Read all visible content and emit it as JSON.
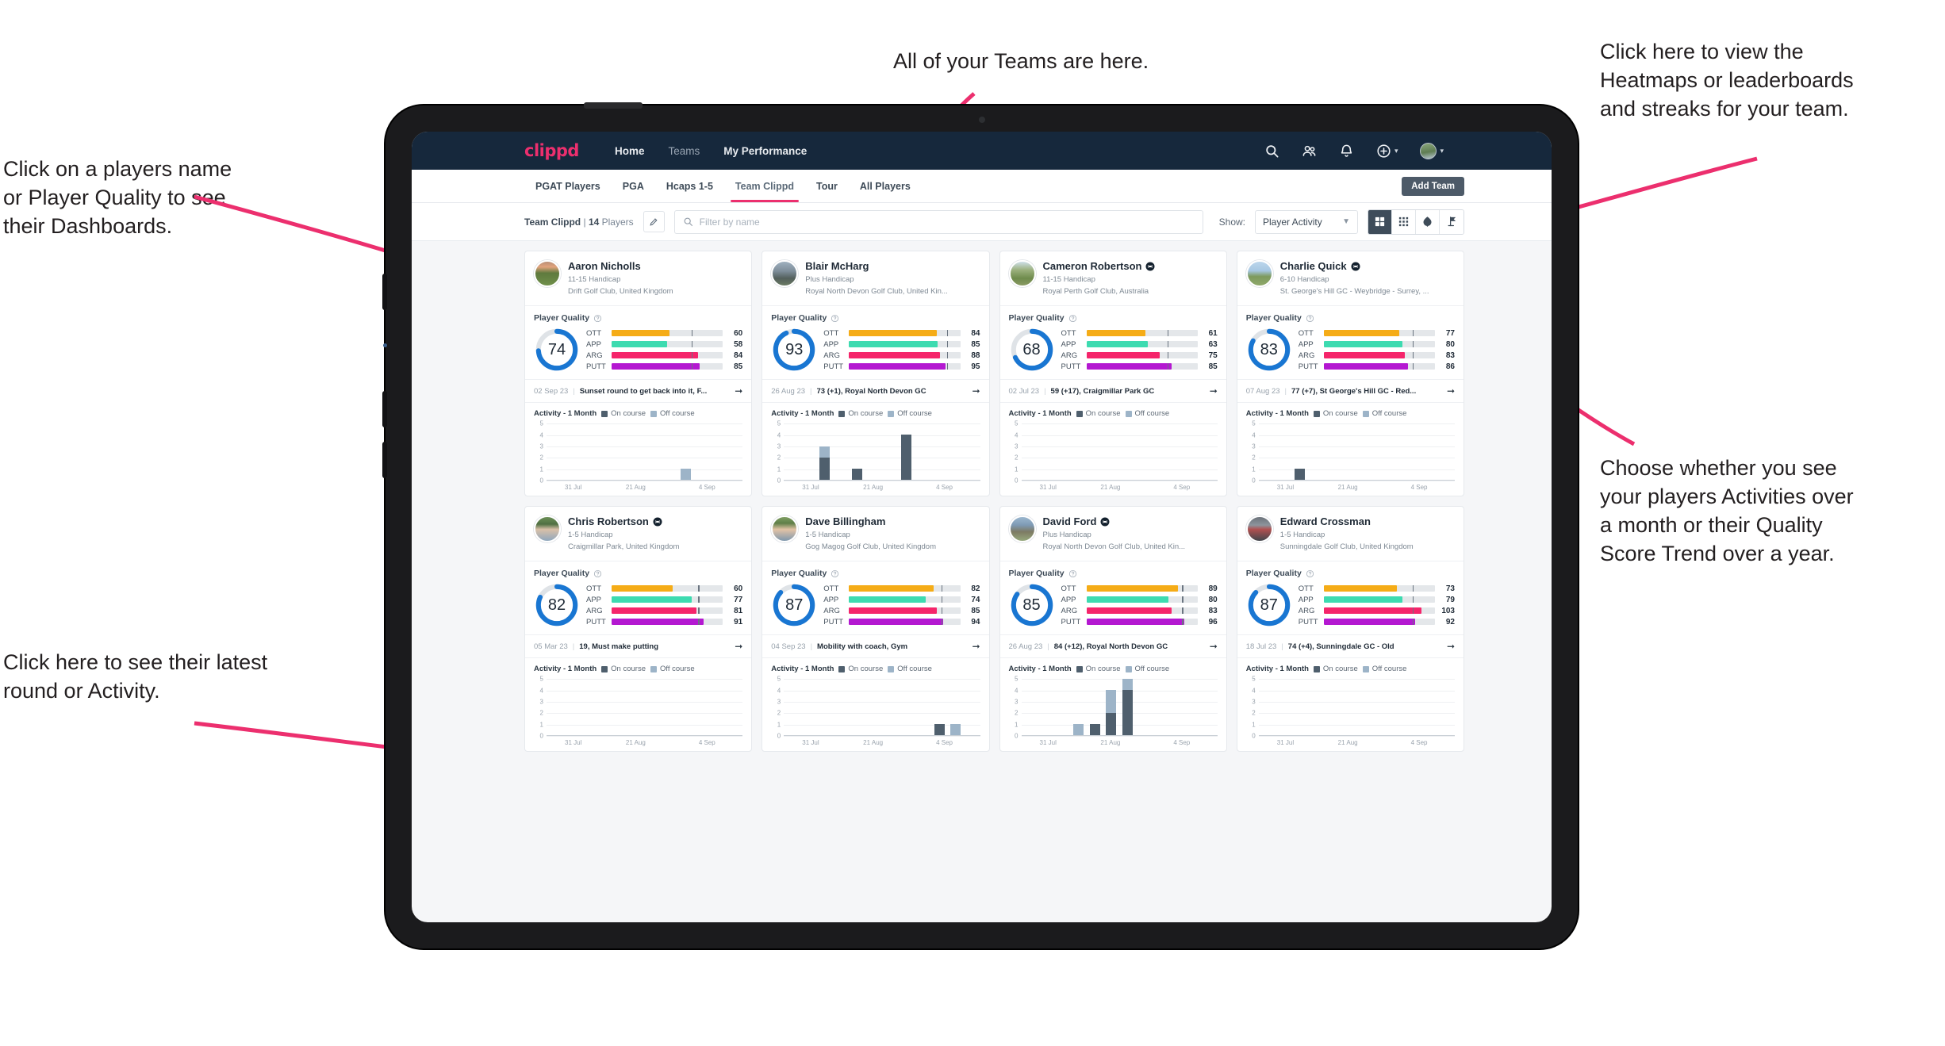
{
  "annotations": [
    {
      "id": "teams",
      "text": "All of your Teams are here."
    },
    {
      "id": "heatmaps",
      "text": "Click here to view the\nHeatmaps or leaderboards\nand streaks for your team."
    },
    {
      "id": "player-name",
      "text": "Click on a players name\nor Player Quality to see\ntheir Dashboards."
    },
    {
      "id": "activity-choice",
      "text": "Choose whether you see\nyour players Activities over\na month or their Quality\nScore Trend over a year."
    },
    {
      "id": "latest-round",
      "text": "Click here to see their latest\nround or Activity."
    }
  ],
  "navbar": {
    "brand": "clippd",
    "links": [
      {
        "label": "Home",
        "active": true
      },
      {
        "label": "Teams",
        "active": false
      },
      {
        "label": "My Performance",
        "active": true
      }
    ],
    "icons": [
      "search-icon",
      "people-icon",
      "bell-icon",
      "plus-circle-icon"
    ],
    "avatar": "user-avatar"
  },
  "tabs": [
    {
      "label": "PGAT Players",
      "active": false
    },
    {
      "label": "PGA",
      "active": false
    },
    {
      "label": "Hcaps 1-5",
      "active": false
    },
    {
      "label": "Team Clippd",
      "active": true
    },
    {
      "label": "Tour",
      "active": false
    },
    {
      "label": "All Players",
      "active": false
    }
  ],
  "add_team_label": "Add Team",
  "filterbar": {
    "team_name": "Team Clippd",
    "separator": "|",
    "player_count": "14",
    "players_word": "Players",
    "edit_icon": "pencil-icon",
    "search_placeholder": "Filter by name",
    "search_value": "",
    "show_label": "Show:",
    "show_value": "Player Activity",
    "show_options": [
      "Player Activity",
      "Quality Score Trend"
    ],
    "view_buttons": [
      {
        "icon": "grid-large-icon",
        "active": true
      },
      {
        "icon": "grid-small-icon",
        "active": false
      },
      {
        "icon": "heatmap-icon",
        "active": false
      },
      {
        "icon": "flag-icon",
        "active": false
      }
    ]
  },
  "card_labels": {
    "quality_title": "Player Quality",
    "activity_title": "Activity - 1 Month",
    "legend_on": "On course",
    "legend_off": "Off course",
    "help_icon": "question-circle-icon",
    "arrow_icon": "arrow-right-icon",
    "verified_icon": "clippd-badge-icon"
  },
  "colors": {
    "brand_pink": "#ec2f6e",
    "navbar_bg": "#16283c",
    "ring_blue": "#1976d2",
    "ott": "#f5ac17",
    "app": "#3ddbb0",
    "arg": "#f5256b",
    "putt": "#b418d1",
    "on_course": "#4f5f6d",
    "off_course": "#9db4c8"
  },
  "chart_data": {
    "type": "bar",
    "title": "Activity - 1 Month",
    "xlabel": "",
    "ylabel": "",
    "ylim": [
      0,
      5
    ],
    "yticks": [
      0,
      1,
      2,
      3,
      4,
      5
    ],
    "xticks": [
      "31 Jul",
      "21 Aug",
      "4 Sep"
    ],
    "legend": [
      "On course",
      "Off course"
    ],
    "legend_position": "top",
    "grid": true,
    "stacked": true,
    "note": "Per-player small multiples; each card has 12 weekly slots; values listed per card in players[].activity"
  },
  "players": [
    {
      "name": "Aaron Nicholls",
      "verified": false,
      "handicap": "11-15 Handicap",
      "club": "Drift Golf Club, United Kingdom",
      "quality": 74,
      "metrics": [
        {
          "label": "OTT",
          "value": 60,
          "fill": 52,
          "tick": 72
        },
        {
          "label": "APP",
          "value": 58,
          "fill": 50,
          "tick": 72
        },
        {
          "label": "ARG",
          "value": 84,
          "fill": 78,
          "tick": 72
        },
        {
          "label": "PUTT",
          "value": 85,
          "fill": 79,
          "tick": 72
        }
      ],
      "round_date": "02 Sep 23",
      "round_desc": "Sunset round to get back into it, F...",
      "activity": [
        {
          "on": 0,
          "off": 0
        },
        {
          "on": 0,
          "off": 0
        },
        {
          "on": 0,
          "off": 0
        },
        {
          "on": 0,
          "off": 0
        },
        {
          "on": 0,
          "off": 0
        },
        {
          "on": 0,
          "off": 0
        },
        {
          "on": 0,
          "off": 0
        },
        {
          "on": 0,
          "off": 0
        },
        {
          "on": 0,
          "off": 1
        },
        {
          "on": 0,
          "off": 0
        },
        {
          "on": 0,
          "off": 0
        },
        {
          "on": 0,
          "off": 0
        }
      ]
    },
    {
      "name": "Blair McHarg",
      "verified": false,
      "handicap": "Plus Handicap",
      "club": "Royal North Devon Golf Club, United Kin...",
      "quality": 93,
      "metrics": [
        {
          "label": "OTT",
          "value": 84,
          "fill": 79,
          "tick": 88
        },
        {
          "label": "APP",
          "value": 85,
          "fill": 80,
          "tick": 88
        },
        {
          "label": "ARG",
          "value": 88,
          "fill": 82,
          "tick": 88
        },
        {
          "label": "PUTT",
          "value": 95,
          "fill": 87,
          "tick": 88
        }
      ],
      "round_date": "26 Aug 23",
      "round_desc": "73 (+1), Royal North Devon GC",
      "activity": [
        {
          "on": 0,
          "off": 0
        },
        {
          "on": 0,
          "off": 0
        },
        {
          "on": 2,
          "off": 1
        },
        {
          "on": 0,
          "off": 0
        },
        {
          "on": 1,
          "off": 0
        },
        {
          "on": 0,
          "off": 0
        },
        {
          "on": 0,
          "off": 0
        },
        {
          "on": 4,
          "off": 0
        },
        {
          "on": 0,
          "off": 0
        },
        {
          "on": 0,
          "off": 0
        },
        {
          "on": 0,
          "off": 0
        },
        {
          "on": 0,
          "off": 0
        }
      ]
    },
    {
      "name": "Cameron Robertson",
      "verified": true,
      "handicap": "11-15 Handicap",
      "club": "Royal Perth Golf Club, Australia",
      "quality": 68,
      "metrics": [
        {
          "label": "OTT",
          "value": 61,
          "fill": 53,
          "tick": 73
        },
        {
          "label": "APP",
          "value": 63,
          "fill": 55,
          "tick": 73
        },
        {
          "label": "ARG",
          "value": 75,
          "fill": 66,
          "tick": 73
        },
        {
          "label": "PUTT",
          "value": 85,
          "fill": 77,
          "tick": 73
        }
      ],
      "round_date": "02 Jul 23",
      "round_desc": "59 (+17), Craigmillar Park GC",
      "activity": [
        {
          "on": 0,
          "off": 0
        },
        {
          "on": 0,
          "off": 0
        },
        {
          "on": 0,
          "off": 0
        },
        {
          "on": 0,
          "off": 0
        },
        {
          "on": 0,
          "off": 0
        },
        {
          "on": 0,
          "off": 0
        },
        {
          "on": 0,
          "off": 0
        },
        {
          "on": 0,
          "off": 0
        },
        {
          "on": 0,
          "off": 0
        },
        {
          "on": 0,
          "off": 0
        },
        {
          "on": 0,
          "off": 0
        },
        {
          "on": 0,
          "off": 0
        }
      ]
    },
    {
      "name": "Charlie Quick",
      "verified": true,
      "handicap": "6-10 Handicap",
      "club": "St. George's Hill GC - Weybridge - Surrey, ...",
      "quality": 83,
      "metrics": [
        {
          "label": "OTT",
          "value": 77,
          "fill": 68,
          "tick": 80
        },
        {
          "label": "APP",
          "value": 80,
          "fill": 71,
          "tick": 80
        },
        {
          "label": "ARG",
          "value": 83,
          "fill": 73,
          "tick": 80
        },
        {
          "label": "PUTT",
          "value": 86,
          "fill": 76,
          "tick": 80
        }
      ],
      "round_date": "07 Aug 23",
      "round_desc": "77 (+7), St George's Hill GC - Red...",
      "activity": [
        {
          "on": 0,
          "off": 0
        },
        {
          "on": 0,
          "off": 0
        },
        {
          "on": 1,
          "off": 0
        },
        {
          "on": 0,
          "off": 0
        },
        {
          "on": 0,
          "off": 0
        },
        {
          "on": 0,
          "off": 0
        },
        {
          "on": 0,
          "off": 0
        },
        {
          "on": 0,
          "off": 0
        },
        {
          "on": 0,
          "off": 0
        },
        {
          "on": 0,
          "off": 0
        },
        {
          "on": 0,
          "off": 0
        },
        {
          "on": 0,
          "off": 0
        }
      ]
    },
    {
      "name": "Chris Robertson",
      "verified": true,
      "handicap": "1-5 Handicap",
      "club": "Craigmillar Park, United Kingdom",
      "quality": 82,
      "metrics": [
        {
          "label": "OTT",
          "value": 60,
          "fill": 55,
          "tick": 78
        },
        {
          "label": "APP",
          "value": 77,
          "fill": 72,
          "tick": 78
        },
        {
          "label": "ARG",
          "value": 81,
          "fill": 76,
          "tick": 78
        },
        {
          "label": "PUTT",
          "value": 91,
          "fill": 83,
          "tick": 78
        }
      ],
      "round_date": "05 Mar 23",
      "round_desc": "19, Must make putting",
      "activity": [
        {
          "on": 0,
          "off": 0
        },
        {
          "on": 0,
          "off": 0
        },
        {
          "on": 0,
          "off": 0
        },
        {
          "on": 0,
          "off": 0
        },
        {
          "on": 0,
          "off": 0
        },
        {
          "on": 0,
          "off": 0
        },
        {
          "on": 0,
          "off": 0
        },
        {
          "on": 0,
          "off": 0
        },
        {
          "on": 0,
          "off": 0
        },
        {
          "on": 0,
          "off": 0
        },
        {
          "on": 0,
          "off": 0
        },
        {
          "on": 0,
          "off": 0
        }
      ]
    },
    {
      "name": "Dave Billingham",
      "verified": false,
      "handicap": "1-5 Handicap",
      "club": "Gog Magog Golf Club, United Kingdom",
      "quality": 87,
      "metrics": [
        {
          "label": "OTT",
          "value": 82,
          "fill": 76,
          "tick": 83
        },
        {
          "label": "APP",
          "value": 74,
          "fill": 69,
          "tick": 83
        },
        {
          "label": "ARG",
          "value": 85,
          "fill": 79,
          "tick": 83
        },
        {
          "label": "PUTT",
          "value": 94,
          "fill": 85,
          "tick": 83
        }
      ],
      "round_date": "04 Sep 23",
      "round_desc": "Mobility with coach, Gym",
      "activity": [
        {
          "on": 0,
          "off": 0
        },
        {
          "on": 0,
          "off": 0
        },
        {
          "on": 0,
          "off": 0
        },
        {
          "on": 0,
          "off": 0
        },
        {
          "on": 0,
          "off": 0
        },
        {
          "on": 0,
          "off": 0
        },
        {
          "on": 0,
          "off": 0
        },
        {
          "on": 0,
          "off": 0
        },
        {
          "on": 0,
          "off": 0
        },
        {
          "on": 1,
          "off": 0
        },
        {
          "on": 0,
          "off": 1
        },
        {
          "on": 0,
          "off": 0
        }
      ]
    },
    {
      "name": "David Ford",
      "verified": true,
      "handicap": "Plus Handicap",
      "club": "Royal North Devon Golf Club, United Kin...",
      "quality": 85,
      "metrics": [
        {
          "label": "OTT",
          "value": 89,
          "fill": 82,
          "tick": 86
        },
        {
          "label": "APP",
          "value": 80,
          "fill": 74,
          "tick": 86
        },
        {
          "label": "ARG",
          "value": 83,
          "fill": 77,
          "tick": 86
        },
        {
          "label": "PUTT",
          "value": 96,
          "fill": 88,
          "tick": 86
        }
      ],
      "round_date": "26 Aug 23",
      "round_desc": "84 (+12), Royal North Devon GC",
      "activity": [
        {
          "on": 0,
          "off": 0
        },
        {
          "on": 0,
          "off": 0
        },
        {
          "on": 0,
          "off": 0
        },
        {
          "on": 0,
          "off": 1
        },
        {
          "on": 1,
          "off": 0
        },
        {
          "on": 2,
          "off": 2
        },
        {
          "on": 4,
          "off": 1
        },
        {
          "on": 0,
          "off": 0
        },
        {
          "on": 0,
          "off": 0
        },
        {
          "on": 0,
          "off": 0
        },
        {
          "on": 0,
          "off": 0
        },
        {
          "on": 0,
          "off": 0
        }
      ]
    },
    {
      "name": "Edward Crossman",
      "verified": false,
      "handicap": "1-5 Handicap",
      "club": "Sunningdale Golf Club, United Kingdom",
      "quality": 87,
      "metrics": [
        {
          "label": "OTT",
          "value": 73,
          "fill": 66,
          "tick": 80
        },
        {
          "label": "APP",
          "value": 79,
          "fill": 71,
          "tick": 80
        },
        {
          "label": "ARG",
          "value": 103,
          "fill": 88,
          "tick": 80
        },
        {
          "label": "PUTT",
          "value": 92,
          "fill": 82,
          "tick": 80
        }
      ],
      "round_date": "18 Jul 23",
      "round_desc": "74 (+4), Sunningdale GC - Old",
      "activity": [
        {
          "on": 0,
          "off": 0
        },
        {
          "on": 0,
          "off": 0
        },
        {
          "on": 0,
          "off": 0
        },
        {
          "on": 0,
          "off": 0
        },
        {
          "on": 0,
          "off": 0
        },
        {
          "on": 0,
          "off": 0
        },
        {
          "on": 0,
          "off": 0
        },
        {
          "on": 0,
          "off": 0
        },
        {
          "on": 0,
          "off": 0
        },
        {
          "on": 0,
          "off": 0
        },
        {
          "on": 0,
          "off": 0
        },
        {
          "on": 0,
          "off": 0
        }
      ]
    }
  ]
}
